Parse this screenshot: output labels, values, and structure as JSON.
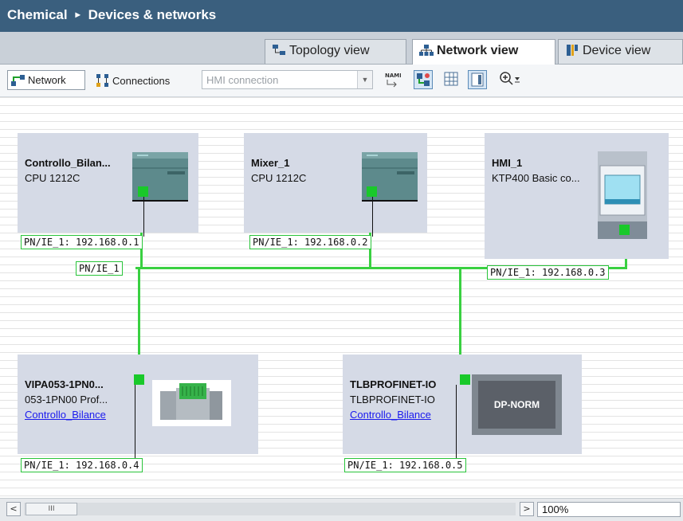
{
  "title": {
    "project": "Chemical",
    "separator": "▸",
    "section": "Devices & networks"
  },
  "tabs": [
    {
      "label": "Topology view",
      "icon": "topology-icon"
    },
    {
      "label": "Network view",
      "icon": "network-icon",
      "active": true
    },
    {
      "label": "Device view",
      "icon": "device-icon"
    }
  ],
  "toolbar": {
    "network_label": "Network",
    "connections_label": "Connections",
    "connection_type": "HMI connection"
  },
  "network": {
    "subnet_label": "PN/IE_1",
    "line_color": "#39d041"
  },
  "devices": [
    {
      "name": "Controllo_Bilan...",
      "type": "CPU 1212C",
      "address": "PN/IE_1: 192.168.0.1"
    },
    {
      "name": "Mixer_1",
      "type": "CPU 1212C",
      "address": "PN/IE_1: 192.168.0.2"
    },
    {
      "name": "HMI_1",
      "type": "KTP400 Basic co...",
      "address": "PN/IE_1: 192.168.0.3"
    },
    {
      "name": "VIPA053-1PN0...",
      "type": "053-1PN00 Prof...",
      "link": "Controllo_Bilance",
      "address": "PN/IE_1: 192.168.0.4"
    },
    {
      "name": "TLBPROFINET-IO",
      "type": "TLBPROFINET-IO",
      "link": "Controllo_Bilance",
      "address": "PN/IE_1: 192.168.0.5",
      "module_label": "DP-NORM"
    }
  ],
  "scrollbar": {
    "left_arrow": "<",
    "thumb": "III",
    "right_arrow": ">"
  },
  "zoom": "100%"
}
